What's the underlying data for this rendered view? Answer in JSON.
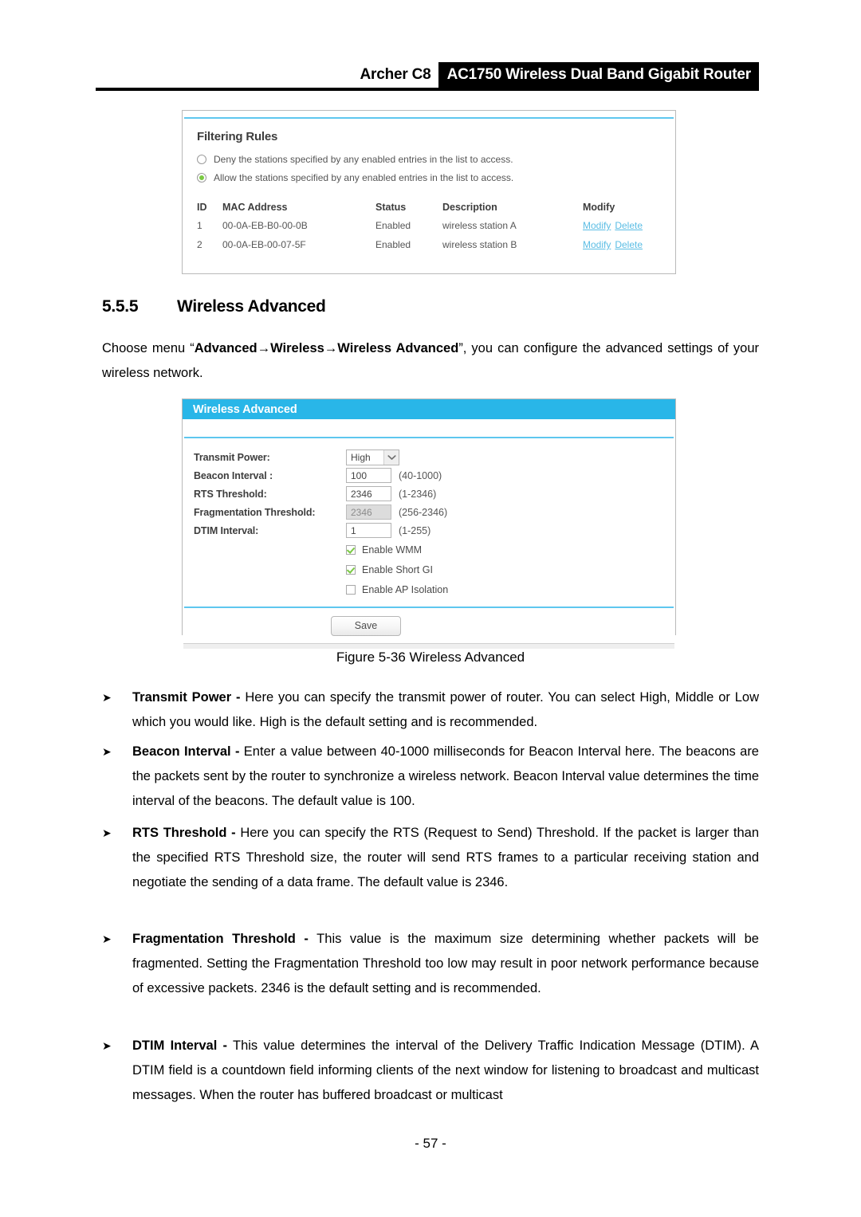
{
  "header": {
    "model": "Archer C8",
    "banner": "AC1750 Wireless Dual Band Gigabit Router"
  },
  "filtering_panel": {
    "title": "Filtering Rules",
    "radio_options": [
      {
        "label": "Deny the stations specified by any enabled entries in the list to access.",
        "selected": false
      },
      {
        "label": "Allow the stations specified by any enabled entries in the list to access.",
        "selected": true
      }
    ],
    "table": {
      "columns": [
        "ID",
        "MAC Address",
        "Status",
        "Description",
        "Modify"
      ],
      "rows": [
        {
          "id": "1",
          "mac": "00-0A-EB-B0-00-0B",
          "status": "Enabled",
          "description": "wireless station A",
          "modify_label": "Modify",
          "delete_label": "Delete"
        },
        {
          "id": "2",
          "mac": "00-0A-EB-00-07-5F",
          "status": "Enabled",
          "description": "wireless station B",
          "modify_label": "Modify",
          "delete_label": "Delete"
        }
      ]
    },
    "link_color": "#5bbde4"
  },
  "section": {
    "number": "5.5.5",
    "title": "Wireless Advanced",
    "intro_prefix": "Choose menu “",
    "intro_path": "Advanced→Wireless→Wireless Advanced",
    "intro_suffix": "”, you can configure the advanced settings of your wireless network."
  },
  "advanced_panel": {
    "title": "Wireless Advanced",
    "accent_color": "#29b6e8",
    "fields": [
      {
        "label": "Transmit Power:",
        "type": "select",
        "value": "High",
        "hint": ""
      },
      {
        "label": "Beacon Interval :",
        "type": "text",
        "value": "100",
        "hint": "(40-1000)"
      },
      {
        "label": "RTS Threshold:",
        "type": "text",
        "value": "2346",
        "hint": "(1-2346)"
      },
      {
        "label": "Fragmentation Threshold:",
        "type": "text-disabled",
        "value": "2346",
        "hint": "(256-2346)"
      },
      {
        "label": "DTIM Interval:",
        "type": "text",
        "value": "1",
        "hint": "(1-255)"
      }
    ],
    "checkboxes": [
      {
        "label": "Enable WMM",
        "checked": true
      },
      {
        "label": "Enable Short GI",
        "checked": true
      },
      {
        "label": "Enable AP Isolation",
        "checked": false
      }
    ],
    "save_label": "Save"
  },
  "figure": {
    "caption": "Figure 5-36 Wireless Advanced"
  },
  "bullets": [
    {
      "term": "Transmit Power -",
      "text": " Here you can specify the transmit power of router. You can select High, Middle or Low which you would like. High is the default setting and is recommended."
    },
    {
      "term": "Beacon Interval -",
      "text": " Enter a value between 40-1000 milliseconds for Beacon Interval here. The beacons are the packets sent by the router to synchronize a wireless network. Beacon Interval value determines the time interval of the beacons. The default value is 100."
    },
    {
      "term": "RTS Threshold -",
      "text": " Here you can specify the RTS (Request to Send) Threshold. If the packet is larger than the specified RTS Threshold size, the router will send RTS frames to a particular receiving station and negotiate the sending of a data frame. The default value is 2346."
    },
    {
      "term": "Fragmentation Threshold -",
      "text": " This value is the maximum size determining whether packets will be fragmented. Setting the Fragmentation Threshold too low may result in poor network performance because of excessive packets. 2346 is the default setting and is recommended."
    },
    {
      "term": "DTIM Interval -",
      "text": " This value determines the interval of the Delivery Traffic Indication Message (DTIM). A DTIM field is a countdown field informing clients of the next window for listening to broadcast and multicast messages. When the router has buffered broadcast or multicast"
    }
  ],
  "footer": {
    "page_number": "- 57 -"
  }
}
